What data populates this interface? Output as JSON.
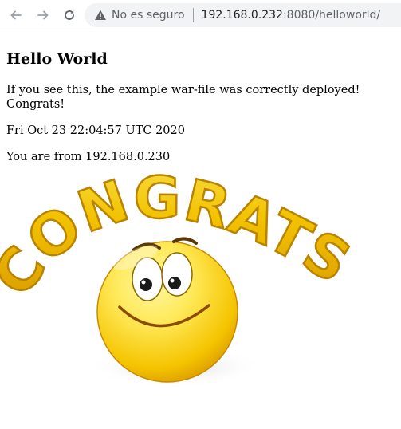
{
  "browser": {
    "security_label": "No es seguro",
    "url_host": "192.168.0.232",
    "url_path": ":8080/helloworld/",
    "icons": {
      "back": "arrow-left-icon",
      "forward": "arrow-right-icon",
      "reload": "reload-icon",
      "security": "warning-triangle-icon"
    }
  },
  "page": {
    "heading": "Hello World",
    "paragraphs": [
      "If you see this, the example war-file was correctly deployed! Congrats!",
      "Fri Oct 23 22:04:57 UTC 2020",
      "You are from 192.168.0.230"
    ],
    "image_text": "CONGRATS!"
  },
  "colors": {
    "letters": "#f2c200",
    "letters_light": "#fff27a",
    "smiley": "#f5c400",
    "smiley_light": "#ffe95a",
    "url_gray": "#5f6368"
  }
}
